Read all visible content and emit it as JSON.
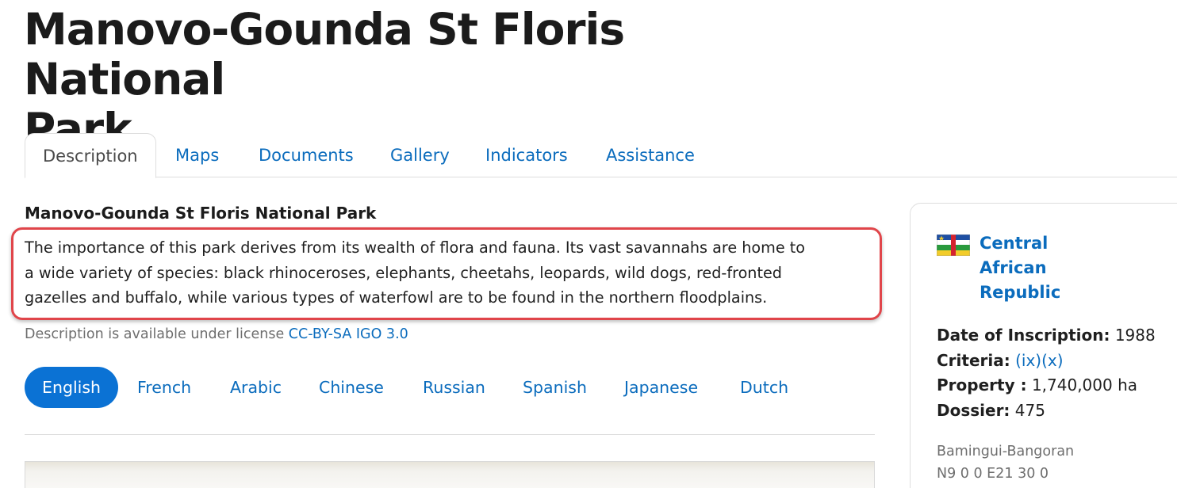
{
  "title_line1": "Manovo-Gounda St Floris National",
  "title_line2": "Park",
  "tabs": [
    {
      "label": "Description"
    },
    {
      "label": "Maps"
    },
    {
      "label": "Documents"
    },
    {
      "label": "Gallery"
    },
    {
      "label": "Indicators"
    },
    {
      "label": "Assistance"
    }
  ],
  "section_title": "Manovo-Gounda St Floris National Park",
  "description": {
    "line1": "The importance of this park derives from its wealth of flora and fauna. Its vast savannahs are home to",
    "line2": "a wide variety of species: black rhinoceroses, elephants, cheetahs, leopards, wild dogs, red-fronted",
    "line3": "gazelles and buffalo, while various types of waterfowl are to be found in the northern floodplains."
  },
  "license": {
    "prefix": "Description is available under license ",
    "link": "CC-BY-SA IGO 3.0"
  },
  "languages": [
    {
      "label": "English"
    },
    {
      "label": "French"
    },
    {
      "label": "Arabic"
    },
    {
      "label": "Chinese"
    },
    {
      "label": "Russian"
    },
    {
      "label": "Spanish"
    },
    {
      "label": "Japanese"
    },
    {
      "label": "Dutch"
    }
  ],
  "sidebar": {
    "flag_icon": "central-african-republic-flag",
    "country_line1": "Central",
    "country_line2": "African",
    "country_line3": "Republic",
    "date_label": "Date of Inscription:",
    "date_value": "1988",
    "criteria_label": "Criteria:",
    "criteria_value": "(ix)(x)",
    "property_label": "Property :",
    "property_value": "1,740,000 ha",
    "dossier_label": "Dossier:",
    "dossier_value": "475",
    "region": "Bamingui-Bangoran",
    "coordinates": "N9 0 0 E21 30 0"
  },
  "colors": {
    "link": "#0b6cbd",
    "active_pill": "#0b72d4",
    "highlight": "#e0454a"
  }
}
